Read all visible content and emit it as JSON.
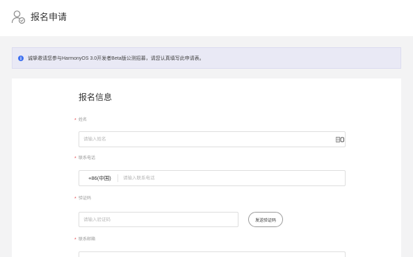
{
  "header": {
    "icon": "user-check-icon",
    "title": "报名申请"
  },
  "notice": {
    "icon": "info-icon",
    "text": "诚挚邀请您参与HarmonyOS 3.0开发者Beta版公测招募，请您认真填写此申请表。"
  },
  "form": {
    "section_title": "报名信息",
    "required_mark": "*",
    "name": {
      "label": "姓名",
      "placeholder": "请输入姓名",
      "value": "",
      "icon": "autofill-icon"
    },
    "phone": {
      "label": "联系电话",
      "country_code": "+86(中国)",
      "placeholder": "请输入联系电话",
      "value": ""
    },
    "verification": {
      "label": "验证码",
      "placeholder": "请输入验证码",
      "value": "",
      "send_button_label": "发送验证码"
    },
    "email": {
      "label": "联系邮箱",
      "value": ""
    }
  },
  "colors": {
    "accent": "#3d6ff0",
    "notice_background": "#e9e9f5",
    "required": "#e5484d",
    "page_background": "#f3f3f4"
  }
}
